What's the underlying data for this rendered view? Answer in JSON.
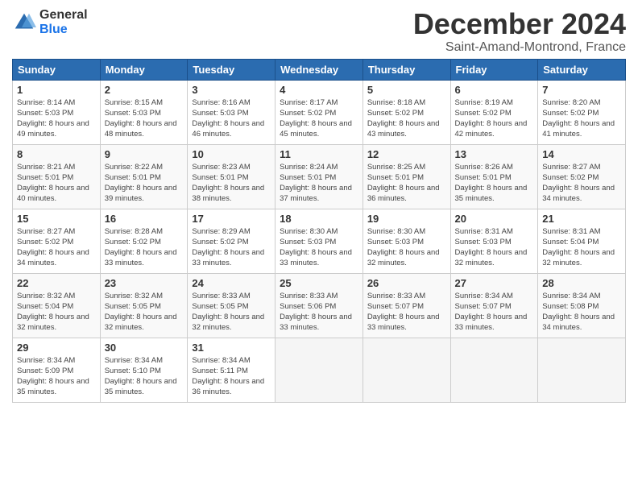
{
  "logo": {
    "general": "General",
    "blue": "Blue"
  },
  "header": {
    "title": "December 2024",
    "subtitle": "Saint-Amand-Montrond, France"
  },
  "columns": [
    "Sunday",
    "Monday",
    "Tuesday",
    "Wednesday",
    "Thursday",
    "Friday",
    "Saturday"
  ],
  "weeks": [
    [
      {
        "day": "1",
        "sunrise": "8:14 AM",
        "sunset": "5:03 PM",
        "daylight": "8 hours and 49 minutes."
      },
      {
        "day": "2",
        "sunrise": "8:15 AM",
        "sunset": "5:03 PM",
        "daylight": "8 hours and 48 minutes."
      },
      {
        "day": "3",
        "sunrise": "8:16 AM",
        "sunset": "5:03 PM",
        "daylight": "8 hours and 46 minutes."
      },
      {
        "day": "4",
        "sunrise": "8:17 AM",
        "sunset": "5:02 PM",
        "daylight": "8 hours and 45 minutes."
      },
      {
        "day": "5",
        "sunrise": "8:18 AM",
        "sunset": "5:02 PM",
        "daylight": "8 hours and 43 minutes."
      },
      {
        "day": "6",
        "sunrise": "8:19 AM",
        "sunset": "5:02 PM",
        "daylight": "8 hours and 42 minutes."
      },
      {
        "day": "7",
        "sunrise": "8:20 AM",
        "sunset": "5:02 PM",
        "daylight": "8 hours and 41 minutes."
      }
    ],
    [
      {
        "day": "8",
        "sunrise": "8:21 AM",
        "sunset": "5:01 PM",
        "daylight": "8 hours and 40 minutes."
      },
      {
        "day": "9",
        "sunrise": "8:22 AM",
        "sunset": "5:01 PM",
        "daylight": "8 hours and 39 minutes."
      },
      {
        "day": "10",
        "sunrise": "8:23 AM",
        "sunset": "5:01 PM",
        "daylight": "8 hours and 38 minutes."
      },
      {
        "day": "11",
        "sunrise": "8:24 AM",
        "sunset": "5:01 PM",
        "daylight": "8 hours and 37 minutes."
      },
      {
        "day": "12",
        "sunrise": "8:25 AM",
        "sunset": "5:01 PM",
        "daylight": "8 hours and 36 minutes."
      },
      {
        "day": "13",
        "sunrise": "8:26 AM",
        "sunset": "5:01 PM",
        "daylight": "8 hours and 35 minutes."
      },
      {
        "day": "14",
        "sunrise": "8:27 AM",
        "sunset": "5:02 PM",
        "daylight": "8 hours and 34 minutes."
      }
    ],
    [
      {
        "day": "15",
        "sunrise": "8:27 AM",
        "sunset": "5:02 PM",
        "daylight": "8 hours and 34 minutes."
      },
      {
        "day": "16",
        "sunrise": "8:28 AM",
        "sunset": "5:02 PM",
        "daylight": "8 hours and 33 minutes."
      },
      {
        "day": "17",
        "sunrise": "8:29 AM",
        "sunset": "5:02 PM",
        "daylight": "8 hours and 33 minutes."
      },
      {
        "day": "18",
        "sunrise": "8:30 AM",
        "sunset": "5:03 PM",
        "daylight": "8 hours and 33 minutes."
      },
      {
        "day": "19",
        "sunrise": "8:30 AM",
        "sunset": "5:03 PM",
        "daylight": "8 hours and 32 minutes."
      },
      {
        "day": "20",
        "sunrise": "8:31 AM",
        "sunset": "5:03 PM",
        "daylight": "8 hours and 32 minutes."
      },
      {
        "day": "21",
        "sunrise": "8:31 AM",
        "sunset": "5:04 PM",
        "daylight": "8 hours and 32 minutes."
      }
    ],
    [
      {
        "day": "22",
        "sunrise": "8:32 AM",
        "sunset": "5:04 PM",
        "daylight": "8 hours and 32 minutes."
      },
      {
        "day": "23",
        "sunrise": "8:32 AM",
        "sunset": "5:05 PM",
        "daylight": "8 hours and 32 minutes."
      },
      {
        "day": "24",
        "sunrise": "8:33 AM",
        "sunset": "5:05 PM",
        "daylight": "8 hours and 32 minutes."
      },
      {
        "day": "25",
        "sunrise": "8:33 AM",
        "sunset": "5:06 PM",
        "daylight": "8 hours and 33 minutes."
      },
      {
        "day": "26",
        "sunrise": "8:33 AM",
        "sunset": "5:07 PM",
        "daylight": "8 hours and 33 minutes."
      },
      {
        "day": "27",
        "sunrise": "8:34 AM",
        "sunset": "5:07 PM",
        "daylight": "8 hours and 33 minutes."
      },
      {
        "day": "28",
        "sunrise": "8:34 AM",
        "sunset": "5:08 PM",
        "daylight": "8 hours and 34 minutes."
      }
    ],
    [
      {
        "day": "29",
        "sunrise": "8:34 AM",
        "sunset": "5:09 PM",
        "daylight": "8 hours and 35 minutes."
      },
      {
        "day": "30",
        "sunrise": "8:34 AM",
        "sunset": "5:10 PM",
        "daylight": "8 hours and 35 minutes."
      },
      {
        "day": "31",
        "sunrise": "8:34 AM",
        "sunset": "5:11 PM",
        "daylight": "8 hours and 36 minutes."
      },
      null,
      null,
      null,
      null
    ]
  ]
}
